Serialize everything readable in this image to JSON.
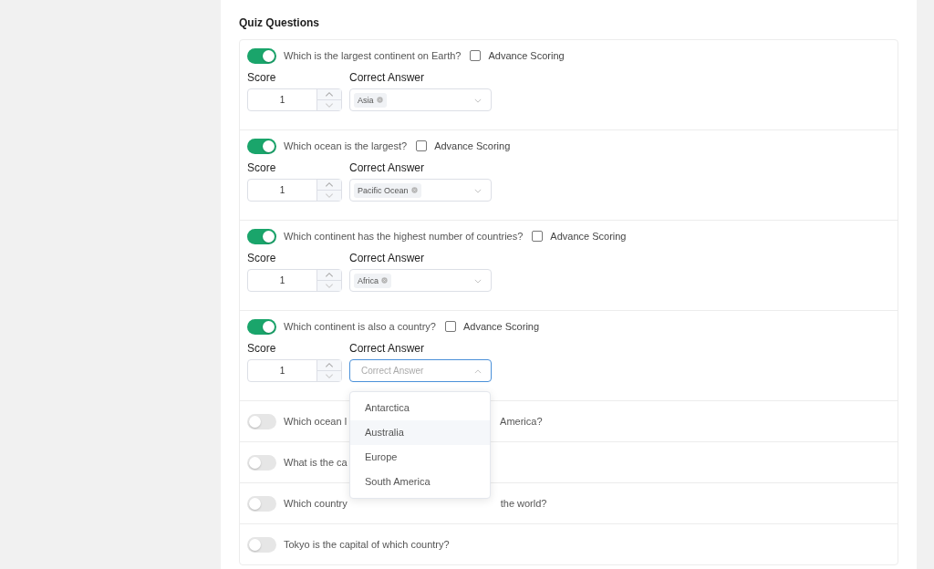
{
  "heading": "Quiz Questions",
  "questions": [
    {
      "enabled": true,
      "text_parts": [
        "Which is the largest continent on Earth?"
      ],
      "advance_scoring": {
        "label": "Advance Scoring",
        "checked": false
      },
      "score_label": "Score",
      "score": "1",
      "answer_label": "Correct Answer",
      "answer": {
        "tags": [
          "Asia"
        ],
        "open": false
      }
    },
    {
      "enabled": true,
      "text_parts": [
        "Which ocean is the largest?"
      ],
      "advance_scoring": {
        "label": "Advance Scoring",
        "checked": false
      },
      "score_label": "Score",
      "score": "1",
      "answer_label": "Correct Answer",
      "answer": {
        "tags": [
          "Pacific Ocean"
        ],
        "open": false
      }
    },
    {
      "enabled": true,
      "text_parts": [
        "Which continent has the highest number of countries?"
      ],
      "advance_scoring": {
        "label": "Advance Scoring",
        "checked": false
      },
      "score_label": "Score",
      "score": "1",
      "answer_label": "Correct Answer",
      "answer": {
        "tags": [
          "Africa"
        ],
        "open": false
      }
    },
    {
      "enabled": true,
      "text_parts": [
        "Which continent is also a country?"
      ],
      "advance_scoring": {
        "label": "Advance Scoring",
        "checked": false
      },
      "score_label": "Score",
      "score": "1",
      "answer_label": "Correct Answer",
      "answer": {
        "placeholder": "Correct Answer",
        "open": true,
        "options": [
          {
            "label": "Antarctica",
            "hovered": false
          },
          {
            "label": "Australia",
            "hovered": true
          },
          {
            "label": "Europe",
            "hovered": false
          },
          {
            "label": "South America",
            "hovered": false
          }
        ]
      }
    },
    {
      "enabled": false,
      "text_parts": [
        "Which ocean l",
        "America?"
      ]
    },
    {
      "enabled": false,
      "text_parts": [
        "What is the ca"
      ]
    },
    {
      "enabled": false,
      "text_parts": [
        "Which country",
        "the world?"
      ]
    },
    {
      "enabled": false,
      "text_parts": [
        "Tokyo is the capital of which country?"
      ]
    }
  ]
}
